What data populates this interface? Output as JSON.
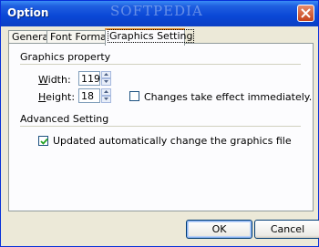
{
  "window": {
    "title": "Option",
    "watermark": "SOFTPEDIA"
  },
  "tabs": [
    {
      "label": "General"
    },
    {
      "label": "Font Format"
    },
    {
      "label": "Graphics Setting",
      "active": true
    }
  ],
  "graphics": {
    "group_label": "Graphics property",
    "width_label": "Width:",
    "width_value": "119",
    "height_label": "Height:",
    "height_value": "18",
    "immediate_label": "Changes take effect immediately.",
    "immediate_checked": false
  },
  "advanced": {
    "group_label": "Advanced Setting",
    "auto_update_label": "Updated automatically change the graphics file",
    "auto_update_checked": true
  },
  "buttons": {
    "ok": "OK",
    "cancel": "Cancel"
  }
}
